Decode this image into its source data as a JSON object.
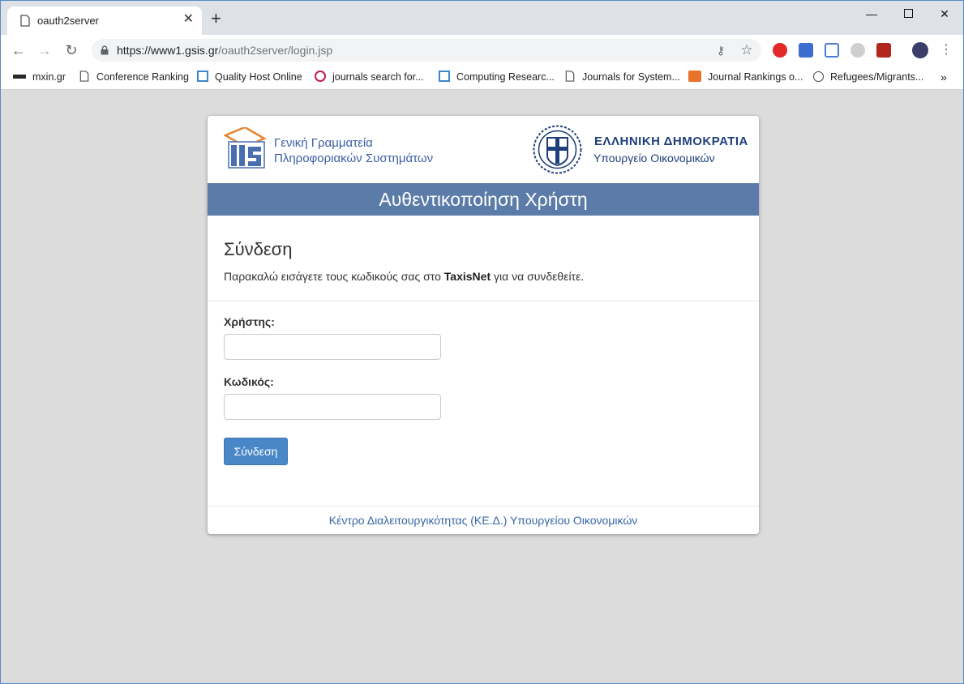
{
  "browser": {
    "tab_title": "oauth2server",
    "url_host": "https://www1.gsis.gr",
    "url_path": "/oauth2server/login.jsp",
    "bookmarks": [
      {
        "label": "mxin.gr",
        "icon": "mxin-icon"
      },
      {
        "label": "Conference Ranking",
        "icon": "page-icon"
      },
      {
        "label": "Quality Host Online",
        "icon": "qho-icon"
      },
      {
        "label": "journals search for...",
        "icon": "swirl-icon"
      },
      {
        "label": "Computing Researc...",
        "icon": "core-icon"
      },
      {
        "label": "Journals for System...",
        "icon": "page-icon"
      },
      {
        "label": "Journal Rankings o...",
        "icon": "sjr-icon"
      },
      {
        "label": "Refugees/Migrants...",
        "icon": "globe-icon"
      }
    ],
    "overflow": "»"
  },
  "header": {
    "gsis_line1": "Γενική Γραμματεία",
    "gsis_line2": "Πληροφοριακών Συστημάτων",
    "gov_title": "ΕΛΛΗΝΙΚΗ ΔΗΜΟΚΡΑΤΙΑ",
    "gov_subtitle": "Υπουργείο Οικονομικών"
  },
  "band_title": "Αυθεντικοποίηση Χρήστη",
  "login": {
    "heading": "Σύνδεση",
    "intro_before": "Παρακαλώ εισάγετε τους κωδικούς σας στο ",
    "intro_bold": "TaxisNet",
    "intro_after": " για να συνδεθείτε.",
    "username_label": "Χρήστης:",
    "username_value": "",
    "password_label": "Κωδικός:",
    "password_value": "",
    "submit_label": "Σύνδεση"
  },
  "footer": "Κέντρο Διαλειτουργικότητας (ΚΕ.Δ.) Υπουργείου Οικονομικών"
}
